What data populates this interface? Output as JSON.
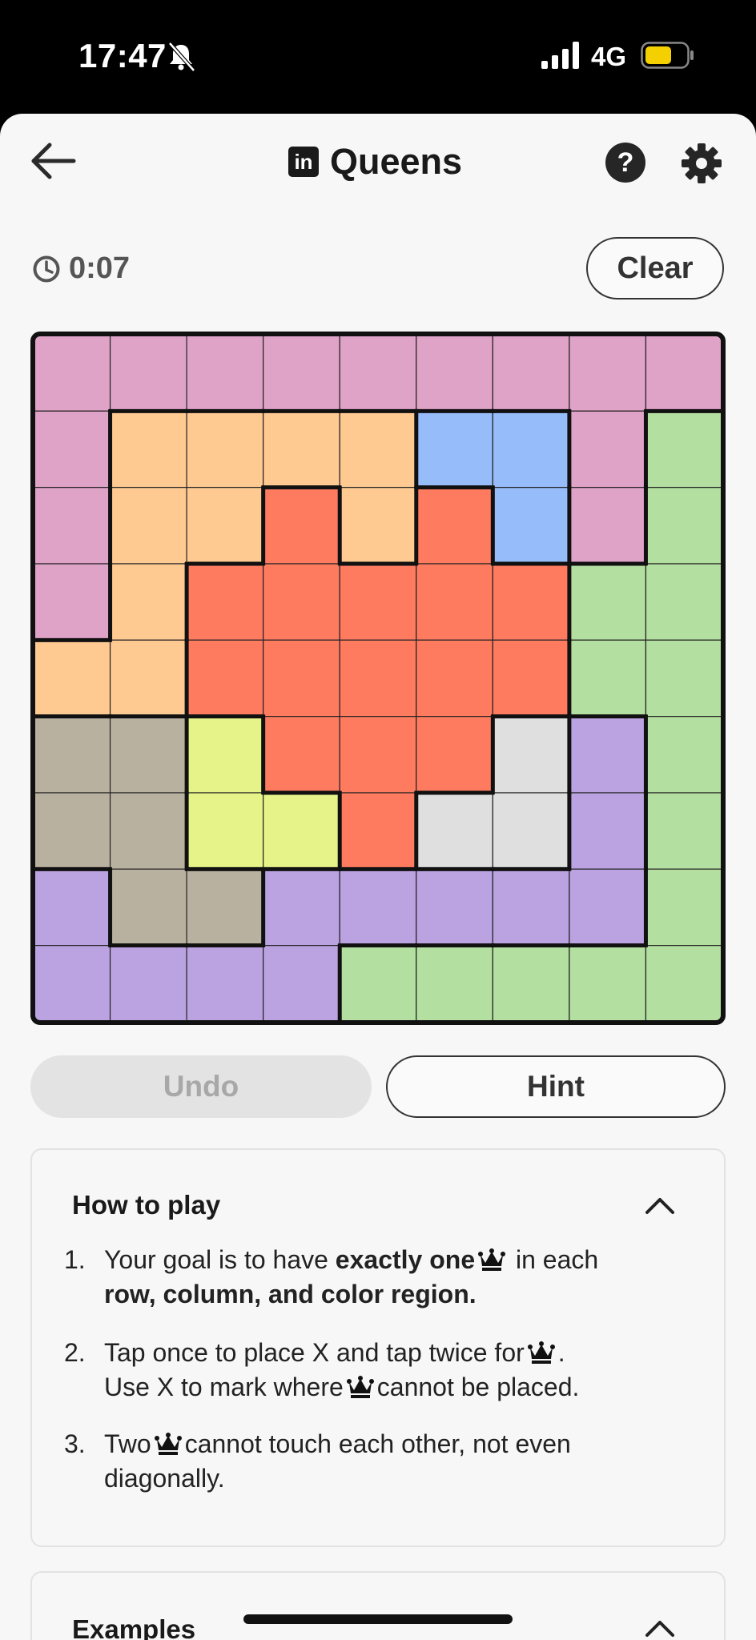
{
  "status_bar": {
    "time": "17:47",
    "network": "4G",
    "battery_color": "#f5d000"
  },
  "header": {
    "logo": "in",
    "title": "Queens"
  },
  "timer": {
    "value": "0:07"
  },
  "actions": {
    "clear_label": "Clear",
    "undo_label": "Undo",
    "hint_label": "Hint"
  },
  "board": {
    "size": 9,
    "colors": {
      "P": "#e0a3c8",
      "O": "#ffc992",
      "B": "#96bcfa",
      "R": "#ff7b60",
      "G": "#b3dfa0",
      "T": "#b9b1a0",
      "Y": "#e6f388",
      "W": "#dfdfdf",
      "V": "#bba3e2"
    },
    "rows": [
      "PPPPPPPPP",
      "POOOOBBPG",
      "POORORBPG",
      "PORRRRRGG",
      "OORRRRRGG",
      "TTYRRRWVG",
      "TTYYRWWVG",
      "VTTVVVVVG",
      "VVVVGGGGG"
    ]
  },
  "how_to_play": {
    "title": "How to play",
    "rules": [
      {
        "num": "1.",
        "parts": [
          "Your goal is to have ",
          "exactly one",
          " in each",
          "row, column, and color region."
        ]
      },
      {
        "num": "2.",
        "parts": [
          "Tap once to place X and tap twice for",
          ".",
          "Use X to mark where",
          "cannot be placed."
        ]
      },
      {
        "num": "3.",
        "parts": [
          "Two",
          "cannot touch each other, not even",
          "diagonally."
        ]
      }
    ]
  },
  "examples": {
    "title": "Examples"
  }
}
